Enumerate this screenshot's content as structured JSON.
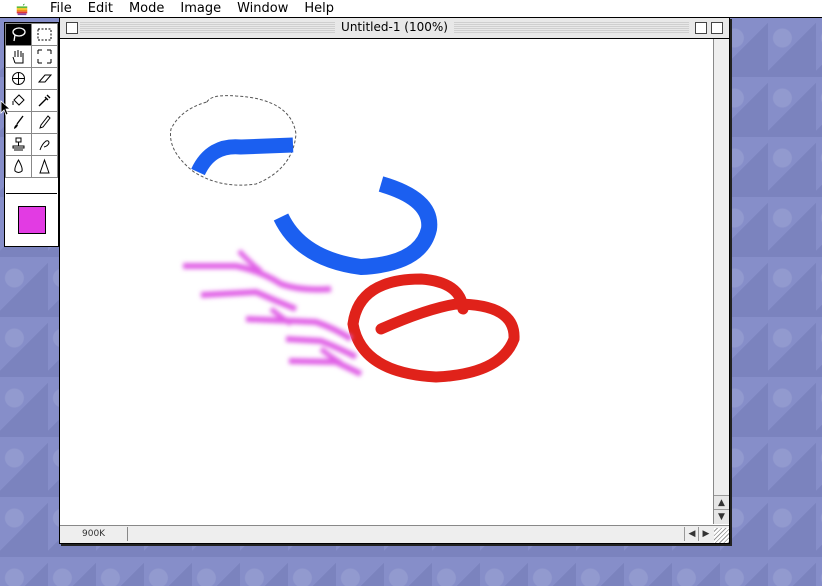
{
  "menubar": {
    "items": [
      "File",
      "Edit",
      "Mode",
      "Image",
      "Window",
      "Help"
    ]
  },
  "window": {
    "title": "Untitled-1 (100%)",
    "size_indicator": "900K"
  },
  "palette": {
    "tools": [
      {
        "name": "lasso-tool-icon",
        "active": true
      },
      {
        "name": "marquee-tool-icon"
      },
      {
        "name": "hand-tool-icon"
      },
      {
        "name": "crop-tool-icon"
      },
      {
        "name": "zoom-tool-icon"
      },
      {
        "name": "eraser-tool-icon"
      },
      {
        "name": "paint-bucket-tool-icon"
      },
      {
        "name": "eyedropper-tool-icon"
      },
      {
        "name": "paintbrush-tool-icon"
      },
      {
        "name": "pencil-tool-icon"
      },
      {
        "name": "rubber-stamp-tool-icon"
      },
      {
        "name": "smudge-tool-icon"
      },
      {
        "name": "blur-tool-icon"
      },
      {
        "name": "sharpen-tool-icon"
      }
    ],
    "foreground_color": "#e23be3"
  },
  "canvas": {
    "stroke_colors": {
      "blue": "#1b5ff0",
      "red": "#e0221a",
      "magenta": "#e060e6"
    }
  }
}
